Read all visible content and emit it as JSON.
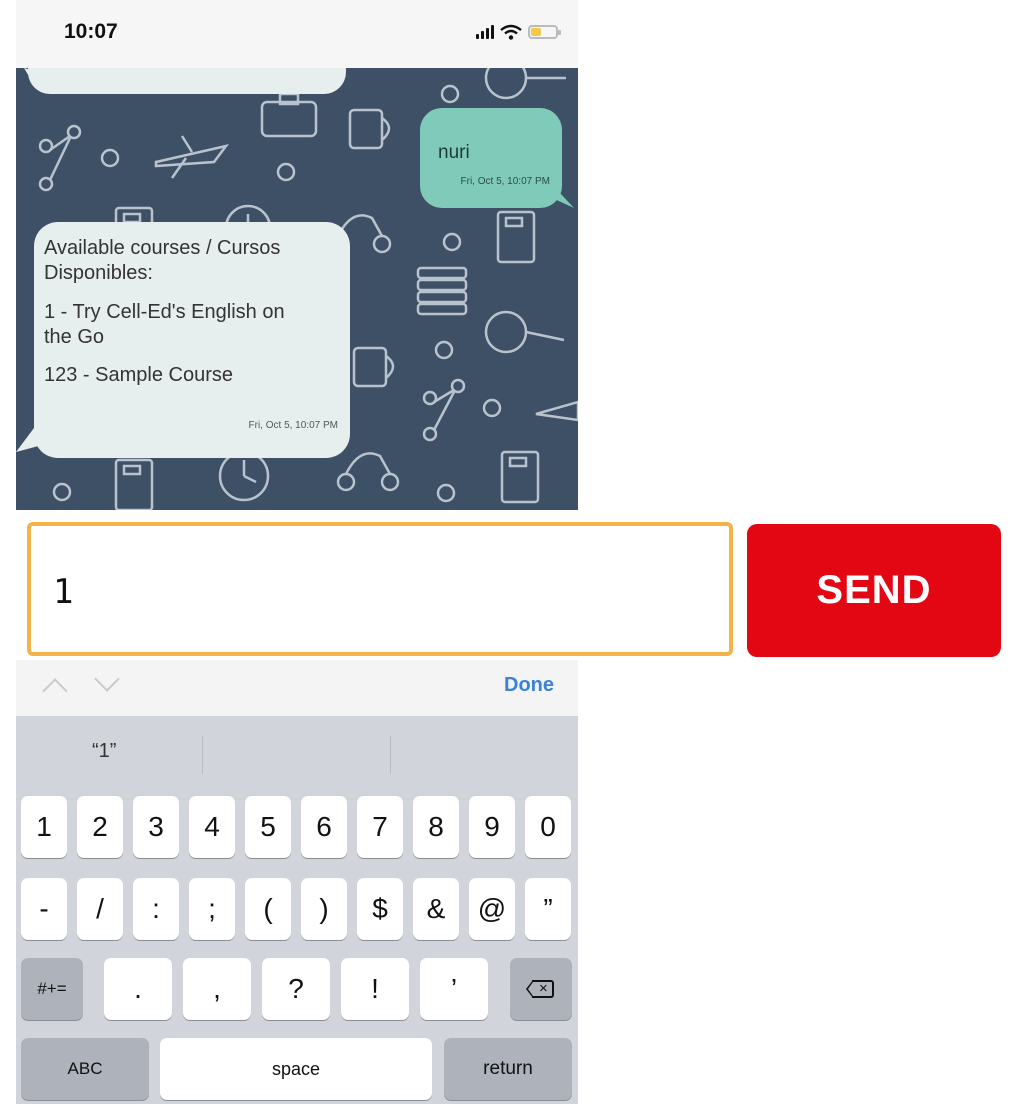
{
  "status_bar": {
    "time": "10:07"
  },
  "chat": {
    "outgoing": {
      "text": "nuri",
      "timestamp": "Fri, Oct 5, 10:07 PM"
    },
    "incoming": {
      "lines": [
        "Available courses / Cursos",
        "Disponibles:",
        "1 - Try Cell-Ed's English on",
        "the Go",
        "123 - Sample Course"
      ],
      "timestamp": "Fri, Oct 5, 10:07 PM"
    }
  },
  "composer": {
    "input_value": "1",
    "send_label": "SEND"
  },
  "toolbar": {
    "done_label": "Done"
  },
  "keyboard": {
    "suggestion": "“1”",
    "row1": [
      "1",
      "2",
      "3",
      "4",
      "5",
      "6",
      "7",
      "8",
      "9",
      "0"
    ],
    "row2": [
      "-",
      "/",
      ":",
      ";",
      "(",
      ")",
      "$",
      "&",
      "@",
      "”"
    ],
    "row3_mode": "#+=",
    "row3": [
      ".",
      ",",
      "?",
      "!",
      "’"
    ],
    "abc_label": "ABC",
    "space_label": "space",
    "return_label": "return"
  },
  "colors": {
    "chat_bg": "#3e5066",
    "outgoing_bubble": "#7fcab9",
    "incoming_bubble": "#e7efee",
    "send": "#e30613",
    "input_border": "#f3b34a",
    "done": "#3b82d6"
  }
}
